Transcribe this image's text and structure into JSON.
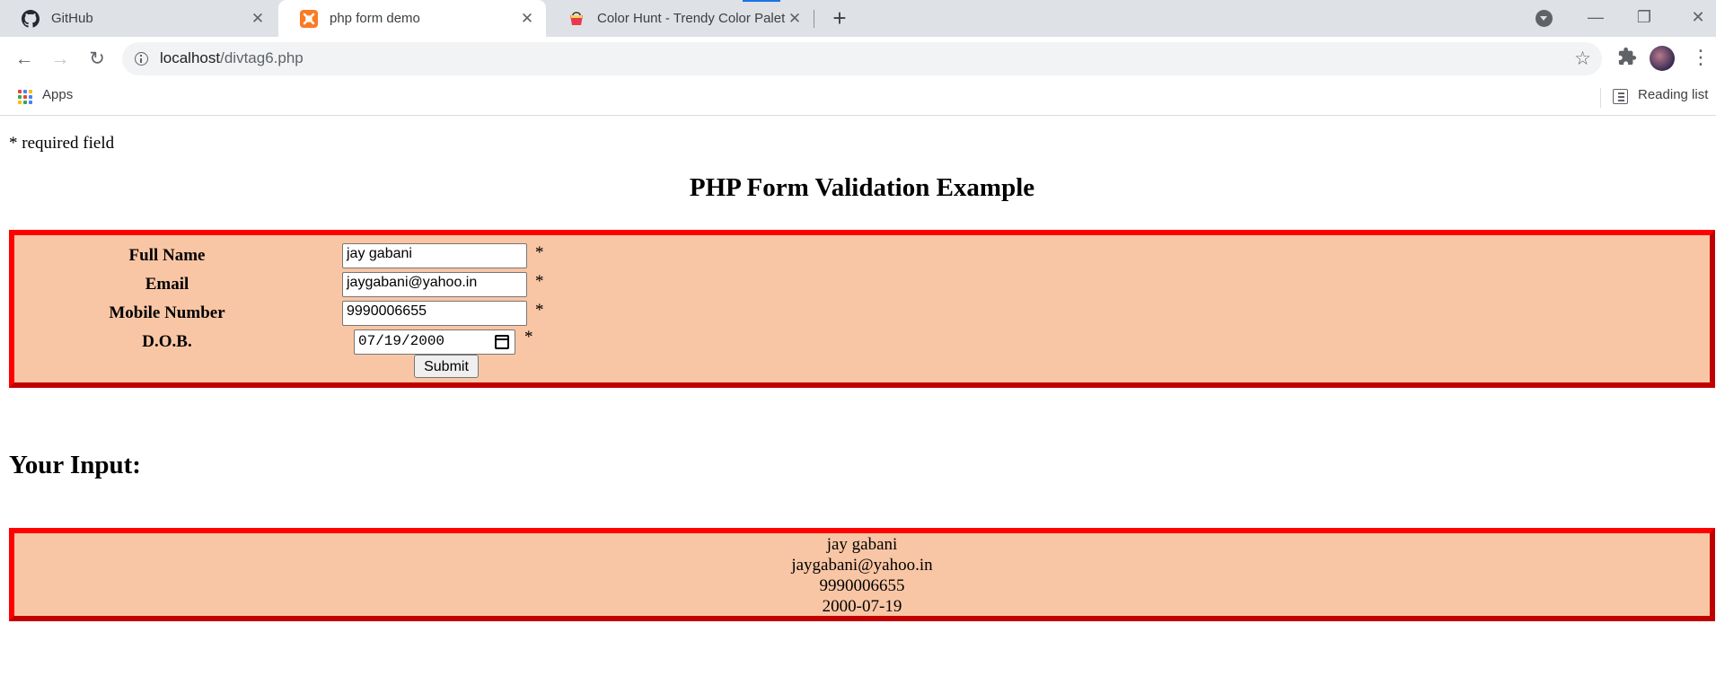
{
  "browser": {
    "tabs": [
      {
        "title": "GitHub",
        "favicon": "github-icon",
        "active": false
      },
      {
        "title": "php form demo",
        "favicon": "xampp-icon",
        "active": true
      },
      {
        "title": "Color Hunt - Trendy Color Palettes",
        "favicon": "color-hunt-icon",
        "active": false
      }
    ],
    "new_tab_label": "+",
    "address": {
      "host": "localhost",
      "path": "/divtag6.php"
    },
    "bookmarks": {
      "apps_label": "Apps",
      "reading_list_label": "Reading list"
    }
  },
  "page": {
    "required_note": "* required field",
    "title": "PHP Form Validation Example",
    "form": {
      "fields": [
        {
          "label": "Full Name",
          "value": "jay gabani"
        },
        {
          "label": "Email",
          "value": "jaygabani@yahoo.in"
        },
        {
          "label": "Mobile Number",
          "value": "9990006655"
        },
        {
          "label": "D.O.B.",
          "value": "07/19/2000"
        }
      ],
      "required_marker": "*",
      "submit_label": "Submit"
    },
    "output": {
      "heading": "Your Input:",
      "lines": [
        "jay gabani",
        "jaygabani@yahoo.in",
        "9990006655",
        "2000-07-19"
      ]
    }
  },
  "colors": {
    "box_background": "#f9c6a5",
    "box_border": "#ff0000",
    "tabstrip_background": "#dee1e6"
  }
}
